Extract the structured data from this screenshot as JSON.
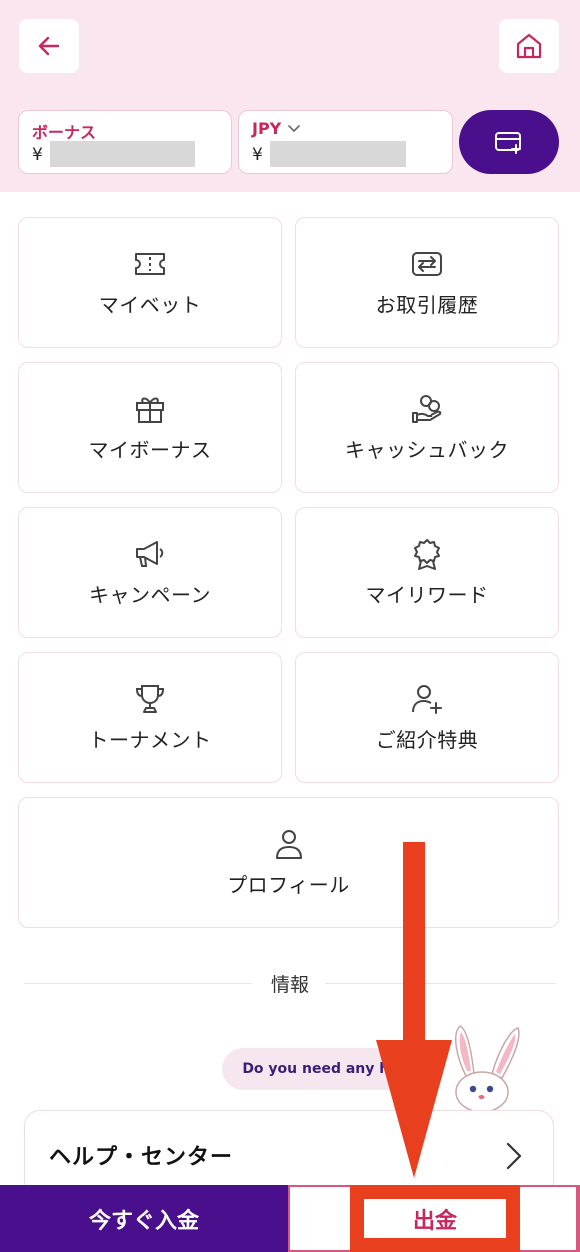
{
  "header": {
    "back_icon": "arrow-left-icon",
    "home_icon": "home-icon",
    "accent": "#c8265f"
  },
  "balances": {
    "bonus": {
      "label": "ボーナス",
      "currency_symbol": "¥"
    },
    "jpy": {
      "label": "JPY",
      "currency_symbol": "¥"
    },
    "wallet_icon": "wallet-plus-icon"
  },
  "menu": {
    "items": [
      {
        "label": "マイベット",
        "icon": "ticket-icon"
      },
      {
        "label": "お取引履歴",
        "icon": "exchange-icon"
      },
      {
        "label": "マイボーナス",
        "icon": "gift-icon"
      },
      {
        "label": "キャッシュバック",
        "icon": "hand-coins-icon"
      },
      {
        "label": "キャンペーン",
        "icon": "megaphone-icon"
      },
      {
        "label": "マイリワード",
        "icon": "award-icon"
      },
      {
        "label": "トーナメント",
        "icon": "trophy-icon"
      },
      {
        "label": "ご紹介特典",
        "icon": "user-plus-icon"
      },
      {
        "label": "プロフィール",
        "icon": "user-icon"
      }
    ]
  },
  "info": {
    "section_title": "情報",
    "help_bubble": "Do you need any help?",
    "help_center_label": "ヘルプ・センター"
  },
  "footer": {
    "deposit_label": "今すぐ入金",
    "withdraw_label": "出金",
    "primary_color": "#4a0f8c",
    "annotation_color": "#e8401f"
  }
}
